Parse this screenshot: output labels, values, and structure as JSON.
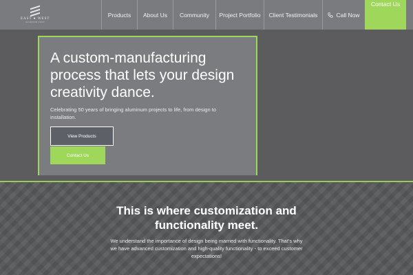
{
  "nav": {
    "logo_text": "EAST ● WEST",
    "logo_subtext": "ALUMINUM CORP",
    "items": [
      {
        "label": "Products"
      },
      {
        "label": "About Us"
      },
      {
        "label": "Community"
      },
      {
        "label": "Project Portfolio"
      },
      {
        "label": "Client Testimonials"
      }
    ],
    "call_label": "Call Now",
    "contact_label": "Contact Us"
  },
  "hero": {
    "title": "A custom-manufacturing process that lets your design creativity dance.",
    "description": "Celebrating 50 years of bringing aluminum projects to life, from design to installation.",
    "primary_button": "View Products",
    "secondary_button": "Contact Us"
  },
  "section": {
    "title": "This is where customization and functionality meet.",
    "description": "We understand the importance of design being married with functionality. That's why we have advanced customization and high-quality functionality - to exceed customer expectations!"
  },
  "colors": {
    "accent": "#9fd75a",
    "nav_bg": "#7a7b7e",
    "card_bg": "#7b7c80",
    "page_bg": "#5c5c5e"
  },
  "icons": {
    "logo": "east-west-logo-icon",
    "call": "phone-icon"
  }
}
